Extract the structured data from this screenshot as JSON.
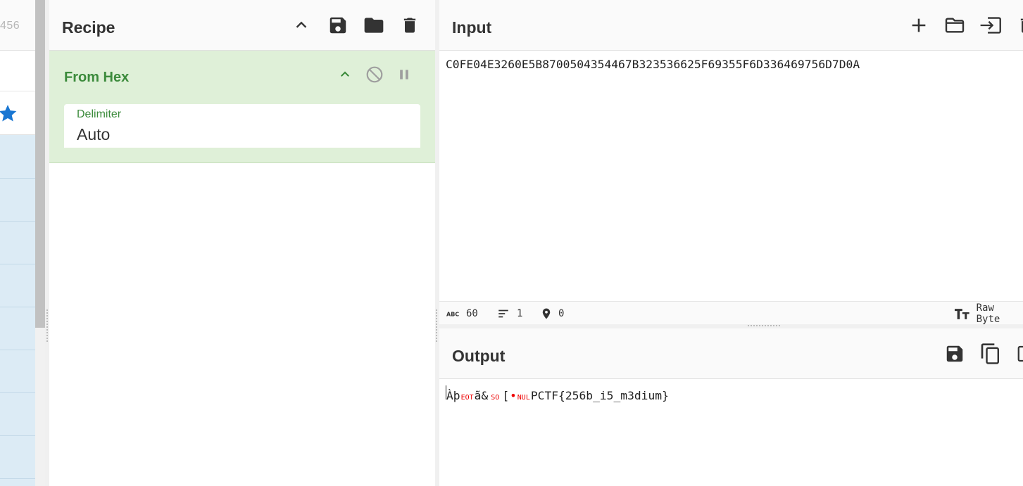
{
  "operations_panel": {
    "top_text": "456"
  },
  "recipe": {
    "title": "Recipe",
    "operation": {
      "name": "From Hex",
      "arg_label": "Delimiter",
      "arg_value": "Auto"
    }
  },
  "input": {
    "title": "Input",
    "text": "C0FE04E3260E5B8700504354467B323536625F69355F6D336469756D7D0A",
    "status": {
      "length": "60",
      "lines": "1",
      "position": "0",
      "encoding": "Raw Byte"
    }
  },
  "output": {
    "title": "Output",
    "segments": {
      "s1": "Àþ",
      "ctrl_eot": "EOT",
      "s2": "ã&",
      "ctrl_so": "SO",
      "s3": "[",
      "ctrl_nul": "NUL",
      "s4": "PCTF{256b_i5_m3dium}"
    }
  },
  "colors": {
    "accent_green": "#3c8b3c",
    "op_card_bg": "#dff0d8",
    "favourite_star": "#1976d2",
    "ops_list_bg": "#dcebf5",
    "control_char": "#e00000"
  },
  "icons": [
    "star-icon",
    "chevron-up-icon",
    "save-icon",
    "folder-icon",
    "trash-icon",
    "disable-icon",
    "pause-icon",
    "plus-icon",
    "import-icon",
    "copy-icon",
    "abc-icon",
    "lines-icon",
    "location-pin-icon",
    "text-size-icon"
  ]
}
